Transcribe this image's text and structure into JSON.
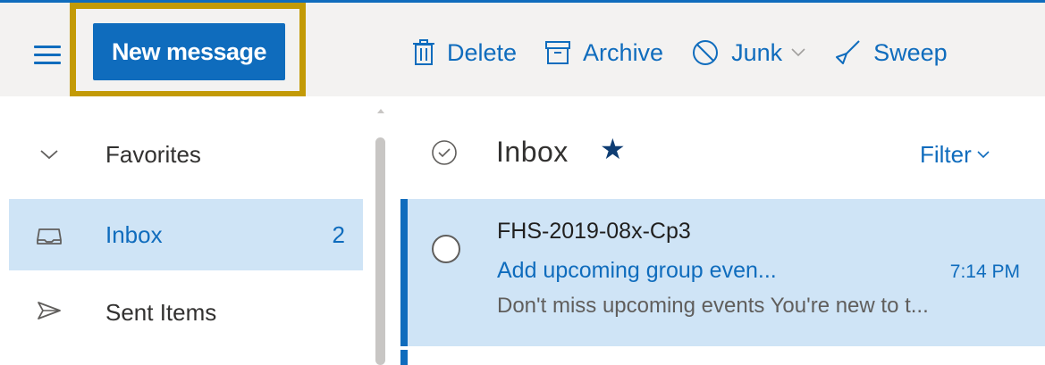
{
  "toolbar": {
    "new_message_label": "New message",
    "actions": [
      {
        "label": "Delete",
        "icon": "trash-icon"
      },
      {
        "label": "Archive",
        "icon": "archive-icon"
      },
      {
        "label": "Junk",
        "icon": "block-icon"
      },
      {
        "label": "Sweep",
        "icon": "broom-icon"
      }
    ]
  },
  "sidebar": {
    "favorites_label": "Favorites",
    "items": [
      {
        "label": "Inbox",
        "count": "2",
        "icon": "inbox-tray-icon",
        "selected": true
      },
      {
        "label": "Sent Items",
        "icon": "send-icon"
      }
    ]
  },
  "message_list": {
    "title": "Inbox",
    "filter_label": "Filter",
    "messages": [
      {
        "sender": "FHS-2019-08x-Cp3",
        "subject": "Add upcoming group even...",
        "time": "7:14 PM",
        "preview": "Don't miss upcoming events You're new to t..."
      }
    ]
  },
  "colors": {
    "accent": "#0f6cbd",
    "highlight_frame": "#c39a06",
    "selected_bg": "#cfe4f6",
    "toolbar_bg": "#f3f2f1"
  }
}
